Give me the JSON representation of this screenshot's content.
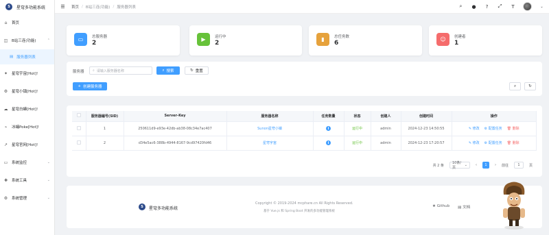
{
  "app": {
    "title": "星穹多功能系统"
  },
  "sidebar": {
    "items": [
      {
        "label": "首页"
      },
      {
        "label": "B站三连(功能)"
      },
      {
        "label": "服务器列表"
      },
      {
        "label": "星穹宇宙[Hot]!"
      },
      {
        "label": "星穹小镇[Hot]!"
      },
      {
        "label": "星穹白蟒[Hot]!"
      },
      {
        "label": "冰蛹Poke[Hot]!"
      },
      {
        "label": "星穹官网[Hot]!"
      },
      {
        "label": "系统监控"
      },
      {
        "label": "系统工具"
      },
      {
        "label": "系统管理"
      }
    ]
  },
  "breadcrumb": {
    "home": "首页",
    "section": "B站三连(功能)",
    "page": "服务器列表"
  },
  "stats": [
    {
      "label": "总服务器",
      "value": "2",
      "color": "#409eff"
    },
    {
      "label": "运行中",
      "value": "2",
      "color": "#67c23a"
    },
    {
      "label": "总任务数",
      "value": "6",
      "color": "#e6a23c"
    },
    {
      "label": "创建者",
      "value": "1",
      "color": "#f56c6c"
    }
  ],
  "filter": {
    "label": "服务器",
    "placeholder": "请输入服务器名称",
    "search_label": "搜索",
    "reset_label": "重置",
    "create_label": "创建服务器"
  },
  "table": {
    "headers": [
      "服务器编号(SID)",
      "Server-Key",
      "服务器名称",
      "任务数量",
      "状态",
      "创建人",
      "创建时间",
      "操作"
    ],
    "rows": [
      {
        "sid": "1",
        "key": "250611d9-e93e-42db-ab38-08c34e7ac407",
        "name": "Sunon星穹小镇",
        "tasks": "i",
        "status": "运行中",
        "creator": "admin",
        "time": "2024-12-23 14:50:55",
        "edit": "修改",
        "cfg": "配置任务",
        "del": "删除"
      },
      {
        "sid": "2",
        "key": "d34e5ac6-388b-4944-8167-9cd97420fd46",
        "name": "星穹宇宙",
        "tasks": "i",
        "status": "运行中",
        "creator": "admin",
        "time": "2024-12-23 17:20:57",
        "edit": "修改",
        "cfg": "配置任务",
        "del": "删除"
      }
    ]
  },
  "pagination": {
    "total": "共 2 条",
    "page_size": "10条/页",
    "current": "1",
    "goto_label": "前往",
    "goto_value": "1",
    "page_suffix": "页"
  },
  "footer": {
    "title": "星穹多功能系统",
    "copyright": "Copyright © 2019-2024 mcphare.cn All Rights Reserved.",
    "sub": "基于 Vue.js 和 Spring Boot 开发的多功能管理系统",
    "github": "Github",
    "docs": "文档"
  }
}
